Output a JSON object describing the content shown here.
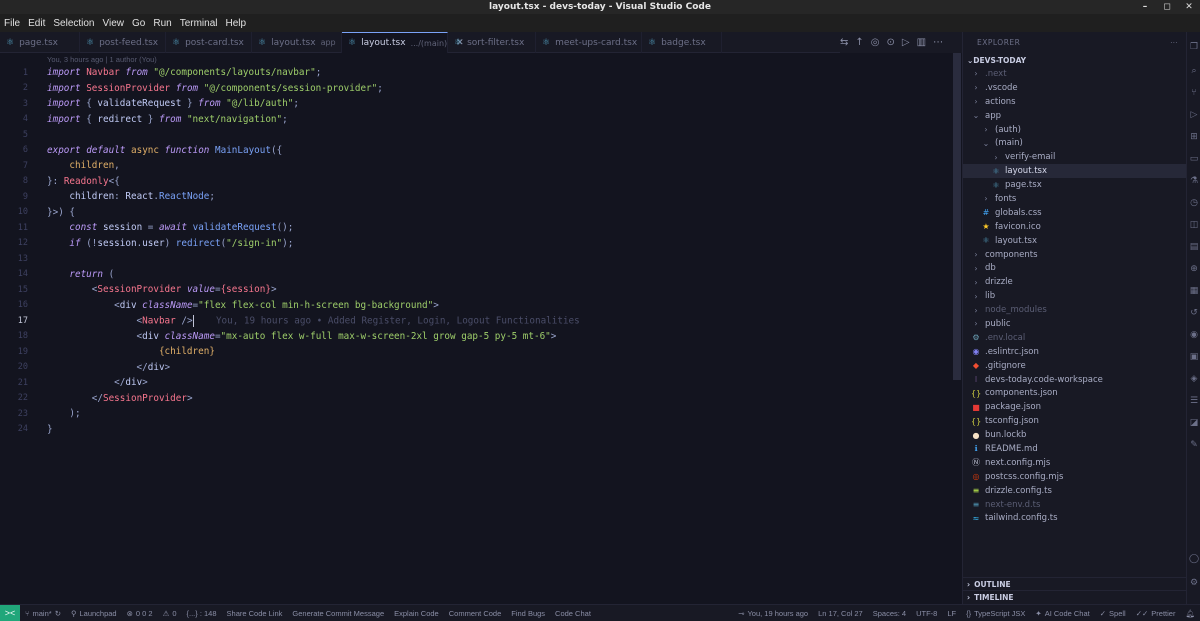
{
  "window": {
    "title": "layout.tsx - devs-today - Visual Studio Code"
  },
  "menu": [
    "File",
    "Edit",
    "Selection",
    "View",
    "Go",
    "Run",
    "Terminal",
    "Help"
  ],
  "tabs": [
    {
      "label": "page.tsx",
      "sub": ""
    },
    {
      "label": "post-feed.tsx",
      "sub": ""
    },
    {
      "label": "post-card.tsx",
      "sub": ""
    },
    {
      "label": "layout.tsx",
      "sub": "app"
    },
    {
      "label": "layout.tsx",
      "sub": ".../(main)",
      "active": true
    },
    {
      "label": "sort-filter.tsx",
      "sub": ""
    },
    {
      "label": "meet-ups-card.tsx",
      "sub": ""
    },
    {
      "label": "badge.tsx",
      "sub": ""
    }
  ],
  "editor": {
    "blame": "You, 3 hours ago | 1 author (You)",
    "line_numbers": [
      "1",
      "2",
      "3",
      "4",
      "5",
      "6",
      "7",
      "8",
      "9",
      "10",
      "11",
      "12",
      "13",
      "14",
      "15",
      "16",
      "17",
      "18",
      "19",
      "20",
      "21",
      "22",
      "23",
      "24"
    ],
    "current_line": "17",
    "ghost_text": "You, 19 hours ago • Added Register, Login, Logout Functionalities",
    "code": {
      "l1": [
        "import",
        " Navbar ",
        "from",
        " \"@/components/layouts/navbar\"",
        ";"
      ],
      "l2": [
        "import",
        " SessionProvider ",
        "from",
        " \"@/components/session-provider\"",
        ";"
      ],
      "l3": [
        "import",
        " { ",
        "validateRequest",
        " } ",
        "from",
        " \"@/lib/auth\"",
        ";"
      ],
      "l4": [
        "import",
        " { ",
        "redirect",
        " } ",
        "from",
        " \"next/navigation\"",
        ";"
      ],
      "l6": [
        "export",
        " ",
        "default",
        " ",
        "async",
        " ",
        "function",
        " ",
        "MainLayout",
        "({"
      ],
      "l7": [
        "    ",
        "children",
        ","
      ],
      "l8": [
        "}",
        ": ",
        "Readonly",
        "<{"
      ],
      "l9": [
        "    children",
        ": ",
        "React",
        ".",
        "ReactNode",
        ";"
      ],
      "l10": [
        "}>",
        ") {"
      ],
      "l11": [
        "    ",
        "const",
        " session ",
        "=",
        " ",
        "await",
        " ",
        "validateRequest",
        "();"
      ],
      "l12": [
        "    ",
        "if",
        " (!",
        "session",
        ".",
        "user",
        ") ",
        "redirect",
        "(",
        "\"/sign-in\"",
        ");"
      ],
      "l14": [
        "    ",
        "return",
        " ("
      ],
      "l15": [
        "        <",
        "SessionProvider",
        " ",
        "value",
        "=",
        "{session}",
        ">"
      ],
      "l16": [
        "            <",
        "div",
        " ",
        "className",
        "=",
        "\"flex flex-col min-h-screen bg-background\"",
        ">"
      ],
      "l17": [
        "                <",
        "Navbar",
        " />"
      ],
      "l18": [
        "                <",
        "div",
        " ",
        "className",
        "=",
        "\"mx-auto flex w-full max-w-screen-2xl grow gap-5 py-5 mt-6\"",
        ">"
      ],
      "l19": [
        "                    {children}"
      ],
      "l20": [
        "                </",
        "div",
        ">"
      ],
      "l21": [
        "            </",
        "div",
        ">"
      ],
      "l22": [
        "        </",
        "SessionProvider",
        ">"
      ],
      "l23": [
        "    );"
      ],
      "l24": [
        "}"
      ]
    }
  },
  "explorer": {
    "header": "EXPLORER",
    "root": "DEVS-TODAY",
    "items": [
      {
        "label": ".next",
        "icon": "folder",
        "depth": 0,
        "dim": true
      },
      {
        "label": ".vscode",
        "icon": "folder",
        "depth": 0
      },
      {
        "label": "actions",
        "icon": "folder",
        "depth": 0
      },
      {
        "label": "app",
        "icon": "folder-open",
        "depth": 0
      },
      {
        "label": "(auth)",
        "icon": "folder",
        "depth": 1
      },
      {
        "label": "(main)",
        "icon": "folder-open",
        "depth": 1
      },
      {
        "label": "verify-email",
        "icon": "folder",
        "depth": 2
      },
      {
        "label": "layout.tsx",
        "icon": "react",
        "depth": 2,
        "selected": true
      },
      {
        "label": "page.tsx",
        "icon": "react",
        "depth": 2
      },
      {
        "label": "fonts",
        "icon": "folder",
        "depth": 1
      },
      {
        "label": "globals.css",
        "icon": "css",
        "depth": 1
      },
      {
        "label": "favicon.ico",
        "icon": "star",
        "depth": 1
      },
      {
        "label": "layout.tsx",
        "icon": "react",
        "depth": 1
      },
      {
        "label": "components",
        "icon": "folder",
        "depth": 0
      },
      {
        "label": "db",
        "icon": "folder",
        "depth": 0
      },
      {
        "label": "drizzle",
        "icon": "folder",
        "depth": 0
      },
      {
        "label": "lib",
        "icon": "folder",
        "depth": 0
      },
      {
        "label": "node_modules",
        "icon": "folder",
        "depth": 0,
        "dim": true
      },
      {
        "label": "public",
        "icon": "folder",
        "depth": 0
      },
      {
        "label": ".env.local",
        "icon": "env",
        "depth": 0,
        "dim": true
      },
      {
        "label": ".eslintrc.json",
        "icon": "eslint",
        "depth": 0
      },
      {
        "label": ".gitignore",
        "icon": "git",
        "depth": 0
      },
      {
        "label": "devs-today.code-workspace",
        "icon": "dots",
        "depth": 0
      },
      {
        "label": "components.json",
        "icon": "json",
        "depth": 0
      },
      {
        "label": "package.json",
        "icon": "npm",
        "depth": 0
      },
      {
        "label": "tsconfig.json",
        "icon": "json",
        "depth": 0
      },
      {
        "label": "bun.lockb",
        "icon": "bun",
        "depth": 0
      },
      {
        "label": "README.md",
        "icon": "info",
        "depth": 0
      },
      {
        "label": "next.config.mjs",
        "icon": "next",
        "depth": 0
      },
      {
        "label": "postcss.config.mjs",
        "icon": "postcss",
        "depth": 0
      },
      {
        "label": "drizzle.config.ts",
        "icon": "drizzle",
        "depth": 0
      },
      {
        "label": "next-env.d.ts",
        "icon": "ts",
        "depth": 0,
        "dim": true
      },
      {
        "label": "tailwind.config.ts",
        "icon": "tailwind",
        "depth": 0
      }
    ],
    "outline": "OUTLINE",
    "timeline": "TIMELINE"
  },
  "statusbar": {
    "remote": "><",
    "branch": "main*",
    "launchpad": "Launchpad",
    "problems": "0  0  2",
    "ports": "0",
    "selection": "{...} : 148",
    "items": [
      "Share Code Link",
      "Generate Commit Message",
      "Explain Code",
      "Comment Code",
      "Find Bugs",
      "Code Chat"
    ],
    "blame": "You, 19 hours ago",
    "position": "Ln 17, Col 27",
    "spaces": "Spaces: 4",
    "encoding": "UTF-8",
    "eol": "LF",
    "language": "TypeScript JSX",
    "ai": "AI Code Chat",
    "spell": "Spell",
    "prettier": "Prettier"
  },
  "colors": {
    "accent": "#7aa2f7",
    "remote": "#21a67a",
    "background": "#13141f"
  }
}
